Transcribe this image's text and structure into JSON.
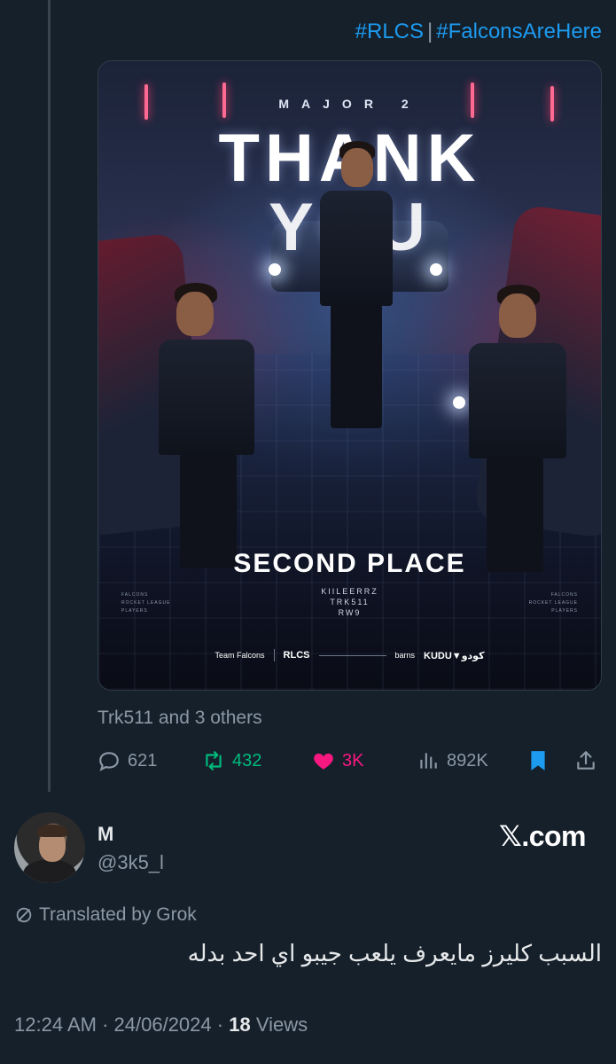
{
  "hashtags": [
    "#RLCS",
    "#FalconsAreHere"
  ],
  "hashtag_separator": "|",
  "poster": {
    "top_text": "MAJOR 2",
    "headline_1": "THANK",
    "headline_2": "YOU",
    "subtitle": "SECOND PLACE",
    "roster": [
      "KIILEERRZ",
      "TRK511",
      "RW9"
    ],
    "side_left": [
      "FALCONS",
      "ROCKET LEAGUE",
      "PLAYERS"
    ],
    "side_right": [
      "FALCONS",
      "ROCKET LEAGUE",
      "PLAYERS"
    ],
    "footer_team": "Team Falcons",
    "footer_rlcs": "RLCS",
    "footer_sponsor_1": "barns",
    "footer_sponsor_2": "KUDU▼كودو"
  },
  "tagged_people": "Trk511 and 3 others",
  "actions": {
    "replies": "621",
    "reposts": "432",
    "likes": "3K",
    "views": "892K"
  },
  "reply": {
    "display_name": "M",
    "handle": "@3k5_l",
    "watermark": "𝕏.com",
    "translated_label": "Translated by Grok",
    "text": "السبب كليرز مايعرف يلعب جيبو اي احد بدله",
    "time": "12:24 AM",
    "date": "24/06/2024",
    "separator": "·",
    "views_count": "18",
    "views_label": "Views"
  },
  "colors": {
    "background": "#15202b",
    "link": "#1d9bf0",
    "muted": "#8b98a5",
    "repost": "#00ba7c",
    "like": "#f91880"
  }
}
